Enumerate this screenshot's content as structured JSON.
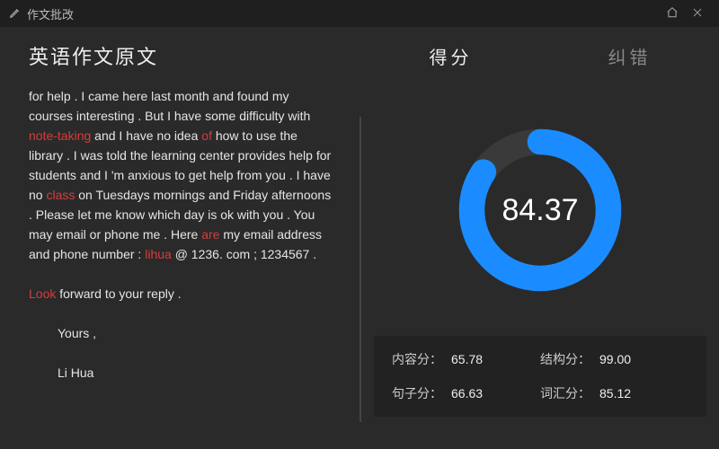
{
  "window": {
    "title": "作文批改",
    "home_icon": "home-icon",
    "close_icon": "close-icon"
  },
  "left": {
    "heading": "英语作文原文",
    "essay_html": "for help . I came here last month and found my courses interesting . But I have some difficulty with <span class='err'>note-taking</span> and I have no idea <span class='err'>of</span> how to use the library . I was told the learning center provides help for students and I 'm anxious to get help from you . I have no <span class='err'>class</span> on Tuesdays mornings and Friday afternoons . Please let me know which day is ok with you . You may email or phone me . Here <span class='err'>are</span> my email address and phone number : <span class='err'>lihua</span> @ 1236. com ; 1234567 .<br><br><span class='err'>Look</span> forward to your reply .<br><br><span class='indent'></span>Yours ,<br><br><span class='indent'></span>Li Hua"
  },
  "tabs": {
    "score": "得分",
    "correct": "纠错",
    "active": "score"
  },
  "score": {
    "total": "84.37",
    "percent": 0.8437,
    "sub": [
      {
        "label": "内容分：",
        "value": "65.78"
      },
      {
        "label": "结构分：",
        "value": "99.00"
      },
      {
        "label": "句子分：",
        "value": "66.63"
      },
      {
        "label": "词汇分：",
        "value": "85.12"
      }
    ]
  },
  "colors": {
    "ring_fg": "#1a8cff",
    "ring_bg": "#3a3a3a"
  }
}
